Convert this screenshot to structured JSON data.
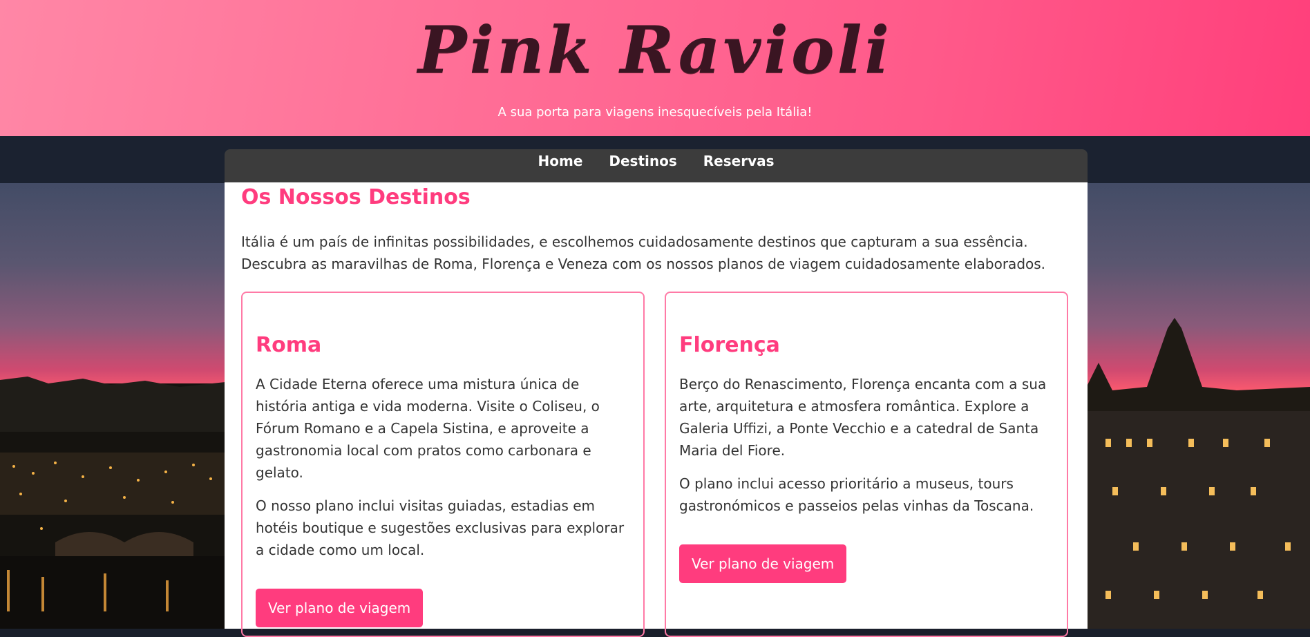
{
  "header": {
    "logo": "Pink Ravioli",
    "tagline": "A sua porta para viagens inesquecíveis pela Itália!"
  },
  "nav": {
    "items": [
      "Home",
      "Destinos",
      "Reservas"
    ]
  },
  "main": {
    "title": "Os Nossos Destinos",
    "intro": "Itália é um país de infinitas possibilidades, e escolhemos cuidadosamente destinos que capturam a sua essência. Descubra as maravilhas de Roma, Florença e Veneza com os nossos planos de viagem cuidadosamente elaborados.",
    "cards": [
      {
        "title": "Roma",
        "p1": "A Cidade Eterna oferece uma mistura única de história antiga e vida moderna. Visite o Coliseu, o Fórum Romano e a Capela Sistina, e aproveite a gastronomia local com pratos como carbonara e gelato.",
        "p2": "O nosso plano inclui visitas guiadas, estadias em hotéis boutique e sugestões exclusivas para explorar a cidade como um local.",
        "button": "Ver plano de viagem"
      },
      {
        "title": "Florença",
        "p1": "Berço do Renascimento, Florença encanta com a sua arte, arquitetura e atmosfera romântica. Explore a Galeria Uffizi, a Ponte Vecchio e a catedral de Santa Maria del Fiore.",
        "p2": "O plano inclui acesso prioritário a museus, tours gastronómicos e passeios pelas vinhas da Toscana.",
        "button": "Ver plano de viagem"
      }
    ]
  },
  "colors": {
    "accent": "#ff3c7e",
    "header_start": "#ff87a6",
    "header_end": "#ff3f7b",
    "nav_bg": "#3c3c3c",
    "card_border": "#ff7aa6"
  }
}
